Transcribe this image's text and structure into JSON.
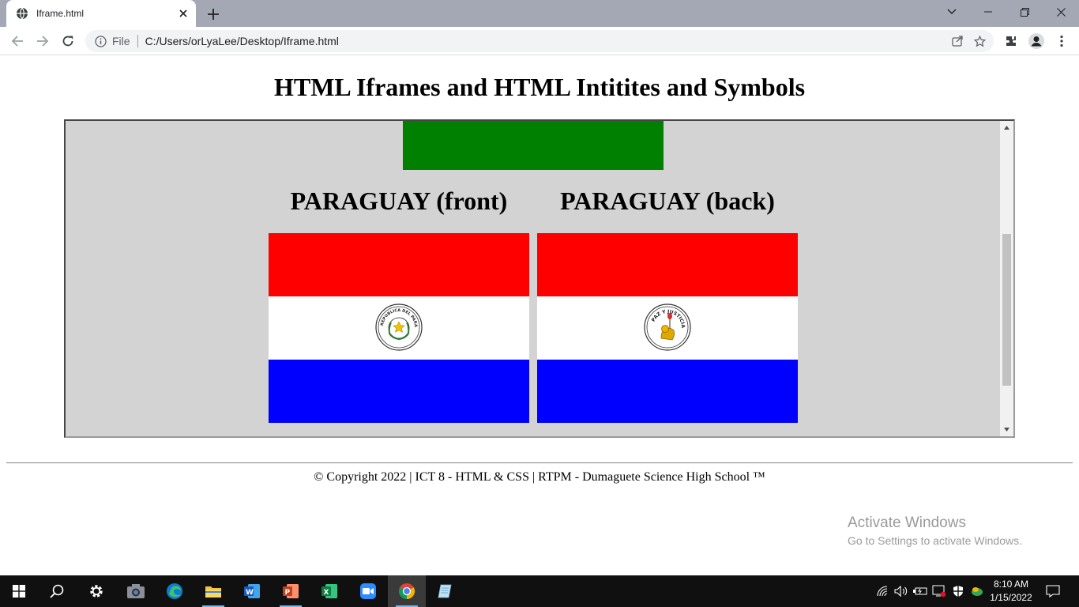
{
  "browser": {
    "tab_title": "Iframe.html",
    "omnibox_scheme": "File",
    "omnibox_url": "C:/Users/orLyaLee/Desktop/Iframe.html"
  },
  "page": {
    "heading": "HTML Iframes and HTML Intitites and Symbols",
    "iframe": {
      "flags": [
        {
          "caption": "PARAGUAY (front)",
          "seal_text": "REPUBLICA DEL PARAGUAY",
          "colors": [
            "#ff0000",
            "#ffffff",
            "#0000ff"
          ]
        },
        {
          "caption": "PARAGUAY (back)",
          "seal_text": "PAZ Y JUSTICIA",
          "colors": [
            "#ff0000",
            "#ffffff",
            "#0000ff"
          ]
        }
      ],
      "top_flag_color": "#008000"
    },
    "footer": "© Copyright 2022 | ICT 8 - HTML & CSS | RTPM - Dumaguete Science High School ™"
  },
  "watermark": {
    "line1": "Activate Windows",
    "line2": "Go to Settings to activate Windows."
  },
  "taskbar": {
    "apps": [
      "start-icon",
      "search-icon",
      "settings-icon",
      "camera-icon",
      "edge-icon",
      "file-explorer-icon",
      "word-icon",
      "powerpoint-icon",
      "excel-icon",
      "zoom-icon",
      "chrome-icon",
      "notepad-icon"
    ],
    "time": "8:10 AM",
    "date": "1/15/2022"
  }
}
